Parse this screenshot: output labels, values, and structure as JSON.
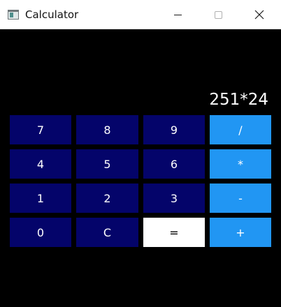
{
  "window": {
    "title": "Calculator"
  },
  "titlebar_icons": {
    "app": "calculator-app-icon",
    "minimize": "minimize-icon",
    "maximize": "maximize-icon",
    "close": "close-icon"
  },
  "display": {
    "expression": "251*24"
  },
  "keypad": {
    "rows": [
      [
        {
          "label": "7",
          "kind": "digit"
        },
        {
          "label": "8",
          "kind": "digit"
        },
        {
          "label": "9",
          "kind": "digit"
        },
        {
          "label": "/",
          "kind": "operator"
        }
      ],
      [
        {
          "label": "4",
          "kind": "digit"
        },
        {
          "label": "5",
          "kind": "digit"
        },
        {
          "label": "6",
          "kind": "digit"
        },
        {
          "label": "*",
          "kind": "operator"
        }
      ],
      [
        {
          "label": "1",
          "kind": "digit"
        },
        {
          "label": "2",
          "kind": "digit"
        },
        {
          "label": "3",
          "kind": "digit"
        },
        {
          "label": "-",
          "kind": "operator"
        }
      ],
      [
        {
          "label": "0",
          "kind": "digit"
        },
        {
          "label": "C",
          "kind": "clear"
        },
        {
          "label": "=",
          "kind": "equals"
        },
        {
          "label": "+",
          "kind": "operator"
        }
      ]
    ]
  },
  "colors": {
    "background": "#000000",
    "titlebar": "#ffffff",
    "digit_key": "#04046a",
    "operator_key": "#2196f3",
    "equals_key": "#ffffff",
    "key_text": "#ffffff",
    "equals_text": "#000000"
  }
}
